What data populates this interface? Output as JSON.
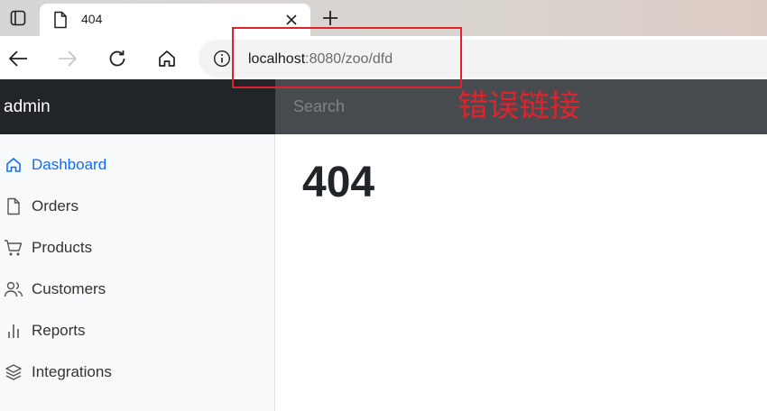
{
  "browser": {
    "tab_title": "404",
    "new_tab_symbol": "+",
    "address": {
      "host": "localhost",
      "rest": ":8080/zoo/dfd"
    },
    "icons": [
      "window-icon",
      "document-icon",
      "close-icon",
      "plus-icon",
      "back-arrow-icon",
      "forward-arrow-icon",
      "reload-icon",
      "home-icon",
      "info-icon"
    ]
  },
  "navbar": {
    "brand": "admin",
    "search_placeholder": "Search",
    "background": "#212529"
  },
  "sidebar": {
    "items": [
      {
        "label": "Dashboard",
        "icon": "home-icon",
        "active": true
      },
      {
        "label": "Orders",
        "icon": "file-icon",
        "active": false
      },
      {
        "label": "Products",
        "icon": "shopping-cart-icon",
        "active": false
      },
      {
        "label": "Customers",
        "icon": "users-icon",
        "active": false
      },
      {
        "label": "Reports",
        "icon": "bar-chart-icon",
        "active": false
      },
      {
        "label": "Integrations",
        "icon": "layers-icon",
        "active": false
      }
    ],
    "active_color": "#0d6efd"
  },
  "main": {
    "heading": "404"
  },
  "annotation": {
    "label": "错误链接",
    "color": "#e0232b"
  }
}
